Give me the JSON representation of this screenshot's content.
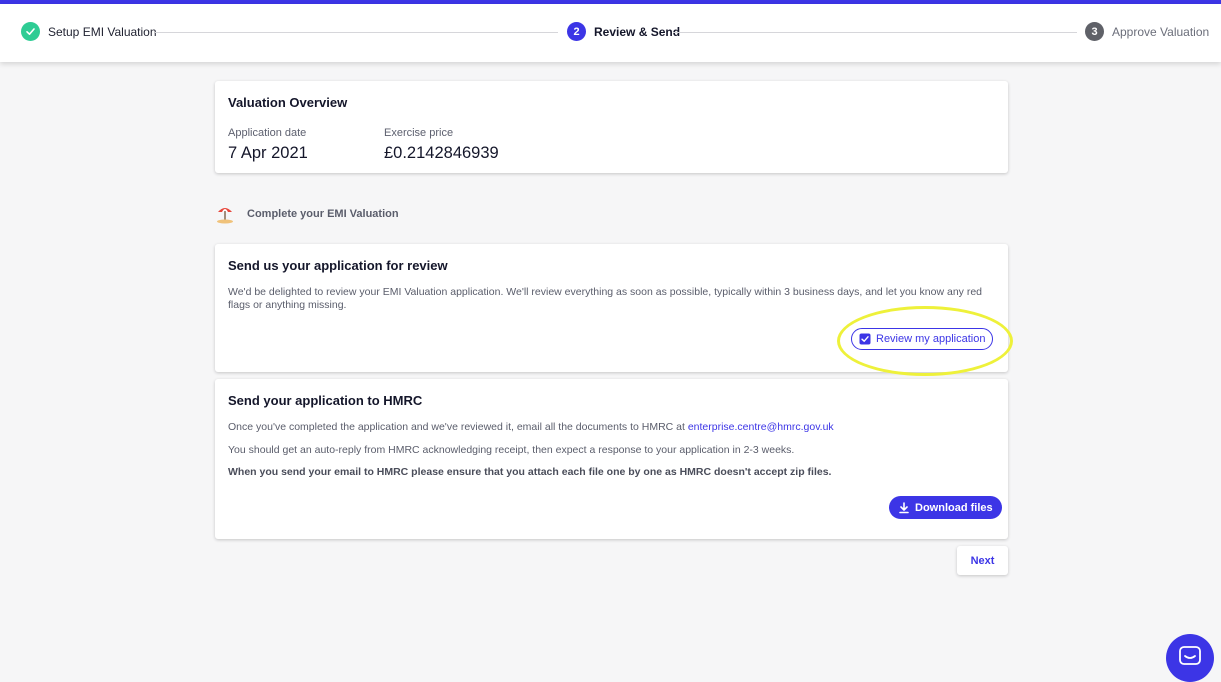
{
  "stepper": {
    "steps": [
      {
        "number": "✓",
        "label": "Setup EMI Valuation",
        "state": "complete"
      },
      {
        "number": "2",
        "label": "Review & Send",
        "state": "active"
      },
      {
        "number": "3",
        "label": "Approve Valuation",
        "state": "pending"
      }
    ]
  },
  "colors": {
    "accent": "#3c35e6",
    "complete": "#2ecc94",
    "pending": "#5f6168",
    "highlight": "#eef13a"
  },
  "overview": {
    "title": "Valuation Overview",
    "application_date_label": "Application date",
    "application_date": "7 Apr 2021",
    "exercise_price_label": "Exercise price",
    "exercise_price": "£0.2142846939"
  },
  "section": {
    "icon": "beach-umbrella-icon",
    "title": "Complete your EMI Valuation"
  },
  "review_card": {
    "title": "Send us your application for review",
    "body": "We'd be delighted to review your EMI Valuation application. We'll review everything as soon as possible, typically within 3 business days, and let you know any red flags or anything missing.",
    "button_label": "Review my application",
    "button_icon": "checkbox-icon"
  },
  "hmrc_card": {
    "title": "Send your application to HMRC",
    "line1_prefix": "Once you've completed the application and we've reviewed it, email all the documents to HMRC at ",
    "email": "enterprise.centre@hmrc.gov.uk",
    "line2": "You should get an auto-reply from HMRC acknowledging receipt, then expect a response to your application in 2-3 weeks.",
    "line3": "When you send your email to HMRC please ensure that you attach each file one by one as HMRC doesn't accept zip files.",
    "download_label": "Download files",
    "download_icon": "download-icon"
  },
  "footer": {
    "next_label": "Next"
  },
  "chat": {
    "icon": "chat-icon"
  }
}
